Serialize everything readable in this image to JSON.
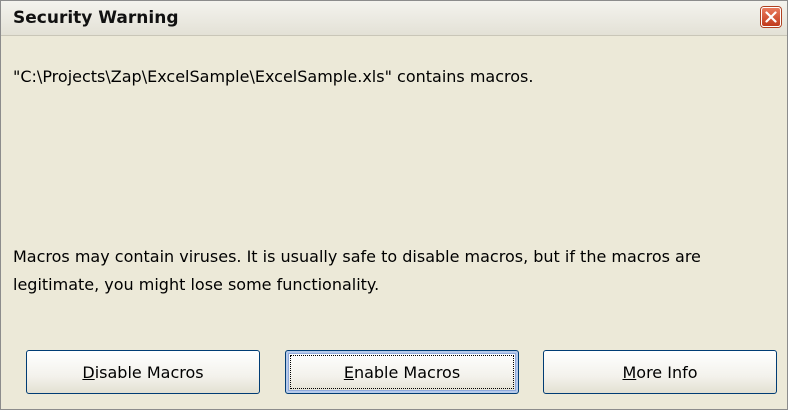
{
  "window": {
    "title": "Security Warning",
    "close_label": "Close"
  },
  "message": {
    "file_line": "\"C:\\Projects\\Zap\\ExcelSample\\ExcelSample.xls\" contains macros.",
    "warning": "Macros may contain viruses. It is usually safe to disable macros, but if the macros are legitimate, you might lose some functionality."
  },
  "buttons": {
    "disable": {
      "accel": "D",
      "rest": "isable Macros"
    },
    "enable": {
      "accel": "E",
      "rest": "nable Macros",
      "focused": true
    },
    "more_info": {
      "accel": "M",
      "rest": "ore Info"
    }
  },
  "colors": {
    "dialog_bg": "#ECE9D8",
    "button_border": "#003C74",
    "close_button": "#C0391B"
  },
  "icons": {
    "close": "close-x-icon"
  }
}
